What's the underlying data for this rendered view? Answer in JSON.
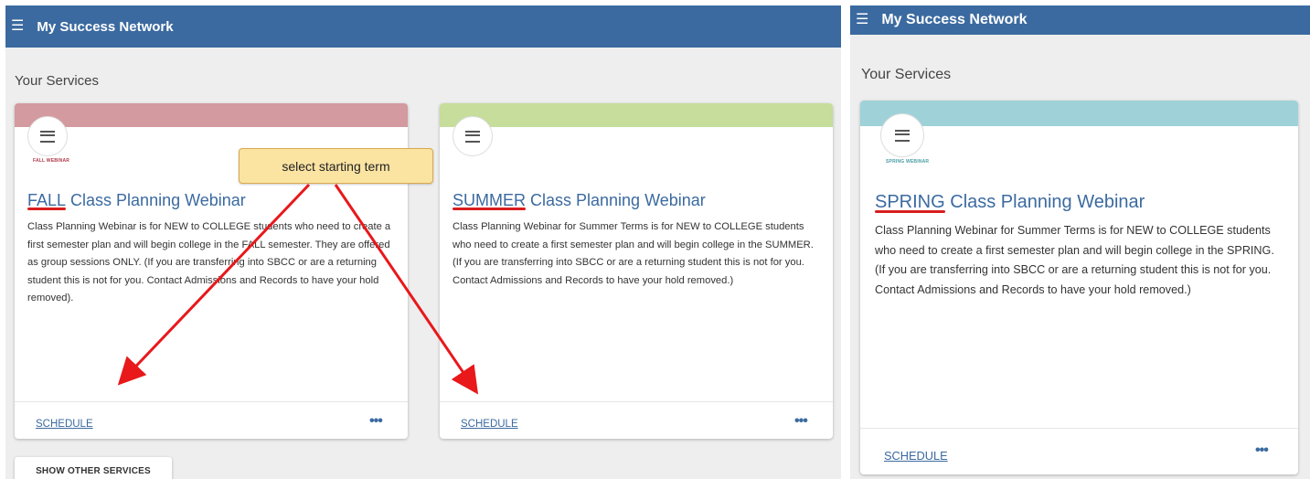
{
  "left_panel": {
    "header": {
      "title": "My Success Network",
      "menu_icon": "hamburger-menu-icon"
    },
    "section_heading": "Your Services",
    "cards": [
      {
        "term": "FALL",
        "title_rest": " Class Planning Webinar",
        "logo_caption": "FALL WEBINAR",
        "band_color": "#d39aa0",
        "description": "Class Planning Webinar is for NEW to COLLEGE students who need to create a first semester plan and will begin college in the FALL semester. They are offered as group sessions ONLY. (If you are transferring into SBCC or are a returning student this is not for you. Contact Admissions and Records to have your hold removed).",
        "schedule_label": "SCHEDULE"
      },
      {
        "term": "SUMMER",
        "title_rest": " Class Planning Webinar",
        "logo_caption": "",
        "band_color": "#c6dd9b",
        "description": "Class Planning Webinar for Summer Terms is for NEW to COLLEGE students who need to create a first semester plan and will begin college in the SUMMER. (If you are transferring into SBCC or are a returning student this is not for you. Contact Admissions and Records to have your hold removed.)",
        "schedule_label": "SCHEDULE"
      }
    ],
    "show_other_services": "SHOW OTHER SERVICES",
    "annotation": {
      "callout_text": "select starting term",
      "arrow_color": "#e8181b"
    }
  },
  "right_panel": {
    "header": {
      "title": "My Success Network",
      "menu_icon": "hamburger-menu-icon"
    },
    "section_heading": "Your Services",
    "card": {
      "term": "SPRING",
      "title_rest": " Class Planning Webinar",
      "logo_caption": "SPRING WEBINAR",
      "band_color": "#9ed2d8",
      "description": "Class Planning Webinar for Summer Terms is for NEW to COLLEGE students who need to create a first semester plan and will begin college in the SPRING. (If you are transferring into SBCC or are a returning student this is not for you. Contact Admissions and Records to have your hold removed.)",
      "schedule_label": "SCHEDULE"
    }
  },
  "colors": {
    "header_bg": "#3b6aa0",
    "link": "#3b6aa0",
    "panel_bg": "#eeeeee"
  }
}
